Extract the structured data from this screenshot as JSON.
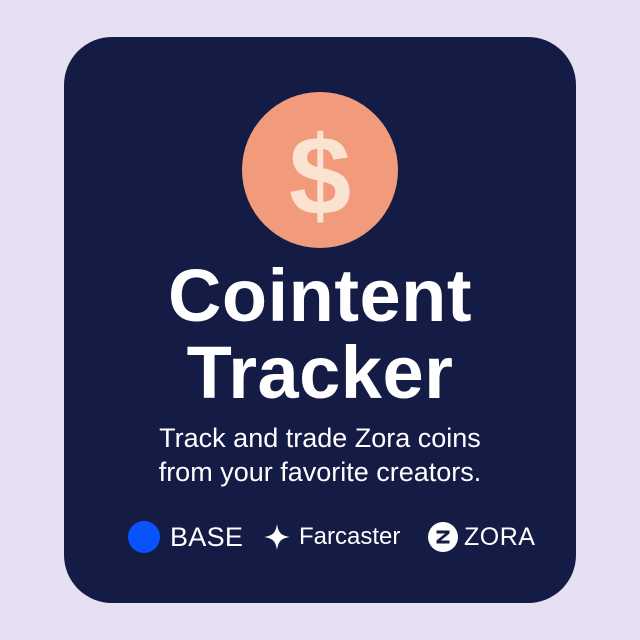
{
  "title": {
    "line1": "Cointent",
    "line2": "Tracker"
  },
  "subtitle": {
    "line1": "Track and trade Zora coins",
    "line2": "from your favorite creators."
  },
  "logo": {
    "icon": "dollar-coin-icon",
    "symbol": "$",
    "coin_color": "#f29b7c",
    "symbol_color": "#fbe3d2"
  },
  "brands": [
    {
      "label": "BASE",
      "icon": "base-dot-icon",
      "color": "#0b52ff"
    },
    {
      "label": "Farcaster",
      "icon": "sparkle-icon",
      "color": "#ffffff"
    },
    {
      "label": "ZORA",
      "icon": "zora-z-icon",
      "color": "#ffffff"
    }
  ],
  "colors": {
    "page_background": "#e7e0f3",
    "card_background": "#141b45",
    "text": "#ffffff"
  }
}
